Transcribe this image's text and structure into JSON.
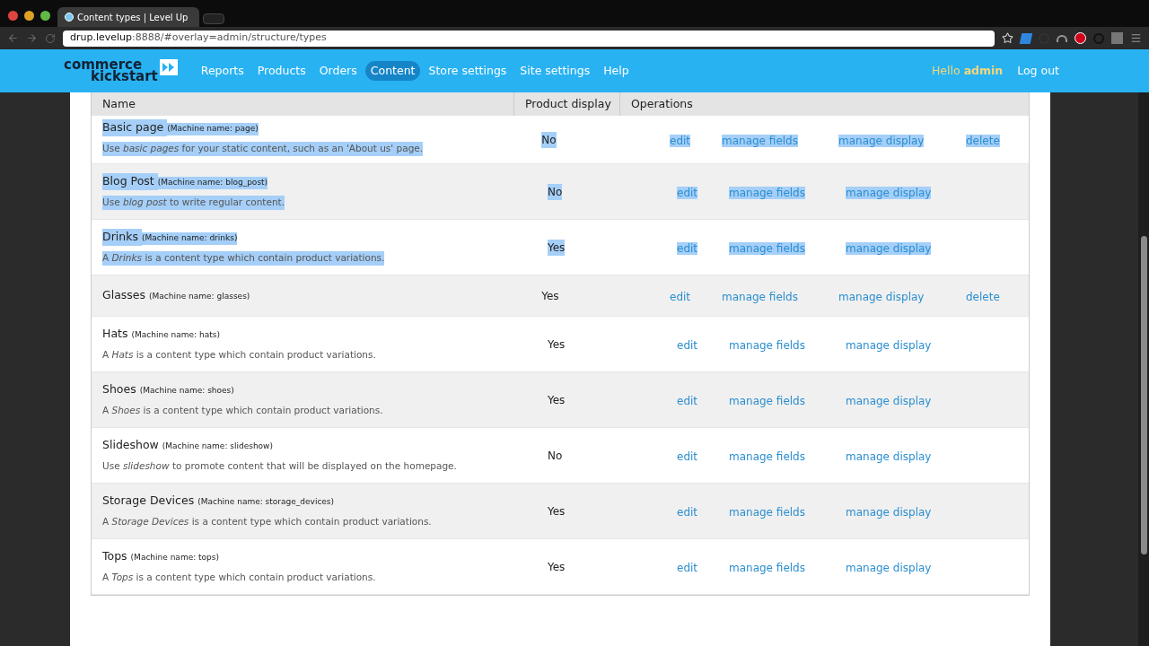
{
  "browser": {
    "tab_title": "Content types | Level Up",
    "url_host": "drup.levelup",
    "url_rest": ":8888/#overlay=admin/structure/types"
  },
  "header": {
    "logo": [
      "commerce",
      "kickstart"
    ],
    "nav": [
      {
        "label": "Reports",
        "selected": false
      },
      {
        "label": "Products",
        "selected": false
      },
      {
        "label": "Orders",
        "selected": false
      },
      {
        "label": "Content",
        "selected": true
      },
      {
        "label": "Store settings",
        "selected": false
      },
      {
        "label": "Site settings",
        "selected": false
      },
      {
        "label": "Help",
        "selected": false
      }
    ],
    "greeting": "Hello",
    "user": "admin",
    "logout": "Log out"
  },
  "table": {
    "columns": [
      "Name",
      "Product display",
      "Operations"
    ],
    "rows": [
      {
        "name": "Basic page",
        "machine_name": "(Machine name: page)",
        "description": "Use *basic pages* for your static content, such as an 'About us' page.",
        "product_display": "No",
        "operations": [
          "edit",
          "manage fields",
          "manage display",
          "delete"
        ],
        "highlighted": true
      },
      {
        "name": "Blog Post",
        "machine_name": "(Machine name: blog_post)",
        "description": "Use *blog post* to write regular content.",
        "product_display": "No",
        "operations": [
          "edit",
          "manage fields",
          "manage display"
        ],
        "highlighted": true
      },
      {
        "name": "Drinks",
        "machine_name": "(Machine name: drinks)",
        "description": "A *Drinks* is a content type which contain product variations.",
        "product_display": "Yes",
        "operations": [
          "edit",
          "manage fields",
          "manage display"
        ],
        "highlighted": true
      },
      {
        "name": "Glasses",
        "machine_name": "(Machine name: glasses)",
        "product_display": "Yes",
        "operations": [
          "edit",
          "manage fields",
          "manage display",
          "delete"
        ],
        "highlighted": false
      },
      {
        "name": "Hats",
        "machine_name": "(Machine name: hats)",
        "description": "A *Hats* is a content type which contain product variations.",
        "product_display": "Yes",
        "operations": [
          "edit",
          "manage fields",
          "manage display"
        ],
        "highlighted": false
      },
      {
        "name": "Shoes",
        "machine_name": "(Machine name: shoes)",
        "description": "A *Shoes* is a content type which contain product variations.",
        "product_display": "Yes",
        "operations": [
          "edit",
          "manage fields",
          "manage display"
        ],
        "highlighted": false
      },
      {
        "name": "Slideshow",
        "machine_name": "(Machine name: slideshow)",
        "description": "Use *slideshow* to promote content that will be displayed on the homepage.",
        "product_display": "No",
        "operations": [
          "edit",
          "manage fields",
          "manage display"
        ],
        "highlighted": false
      },
      {
        "name": "Storage Devices",
        "machine_name": "(Machine name: storage_devices)",
        "description": "A *Storage Devices* is a content type which contain product variations.",
        "product_display": "Yes",
        "operations": [
          "edit",
          "manage fields",
          "manage display"
        ],
        "highlighted": false
      },
      {
        "name": "Tops",
        "machine_name": "(Machine name: tops)",
        "description": "A *Tops* is a content type which contain product variations.",
        "product_display": "Yes",
        "operations": [
          "edit",
          "manage fields",
          "manage display"
        ],
        "highlighted": false
      }
    ]
  }
}
